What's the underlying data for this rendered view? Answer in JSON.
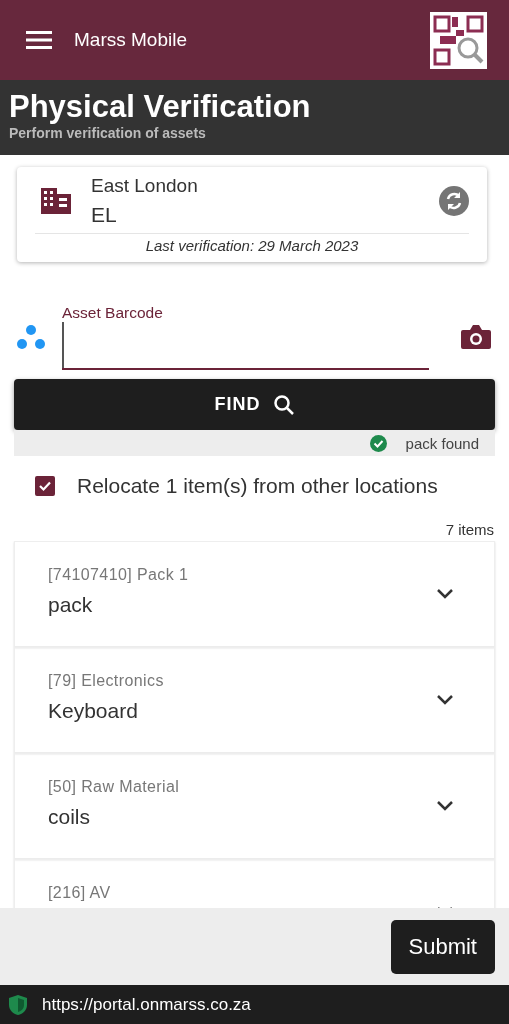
{
  "app_bar": {
    "title": "Marss Mobile"
  },
  "page": {
    "title": "Physical Verification",
    "subtitle": "Perform verification of assets"
  },
  "location": {
    "name": "East London",
    "code": "EL",
    "last_verification": "Last verification: 29 March 2023"
  },
  "barcode_field": {
    "label": "Asset Barcode"
  },
  "find_button": {
    "label": "FIND"
  },
  "status": {
    "message": "pack found"
  },
  "relocate": {
    "label": "Relocate 1 item(s) from other locations",
    "checked": true
  },
  "item_count": "7 items",
  "items": [
    {
      "category": "[74107410] Pack 1",
      "name": "pack"
    },
    {
      "category": "[79] Electronics",
      "name": "Keyboard"
    },
    {
      "category": "[50] Raw Material",
      "name": "coils"
    },
    {
      "category": "[216] AV"
    }
  ],
  "submit_button": {
    "label": "Submit"
  },
  "url_bar": {
    "url": "https://portal.onmarss.co.za"
  }
}
